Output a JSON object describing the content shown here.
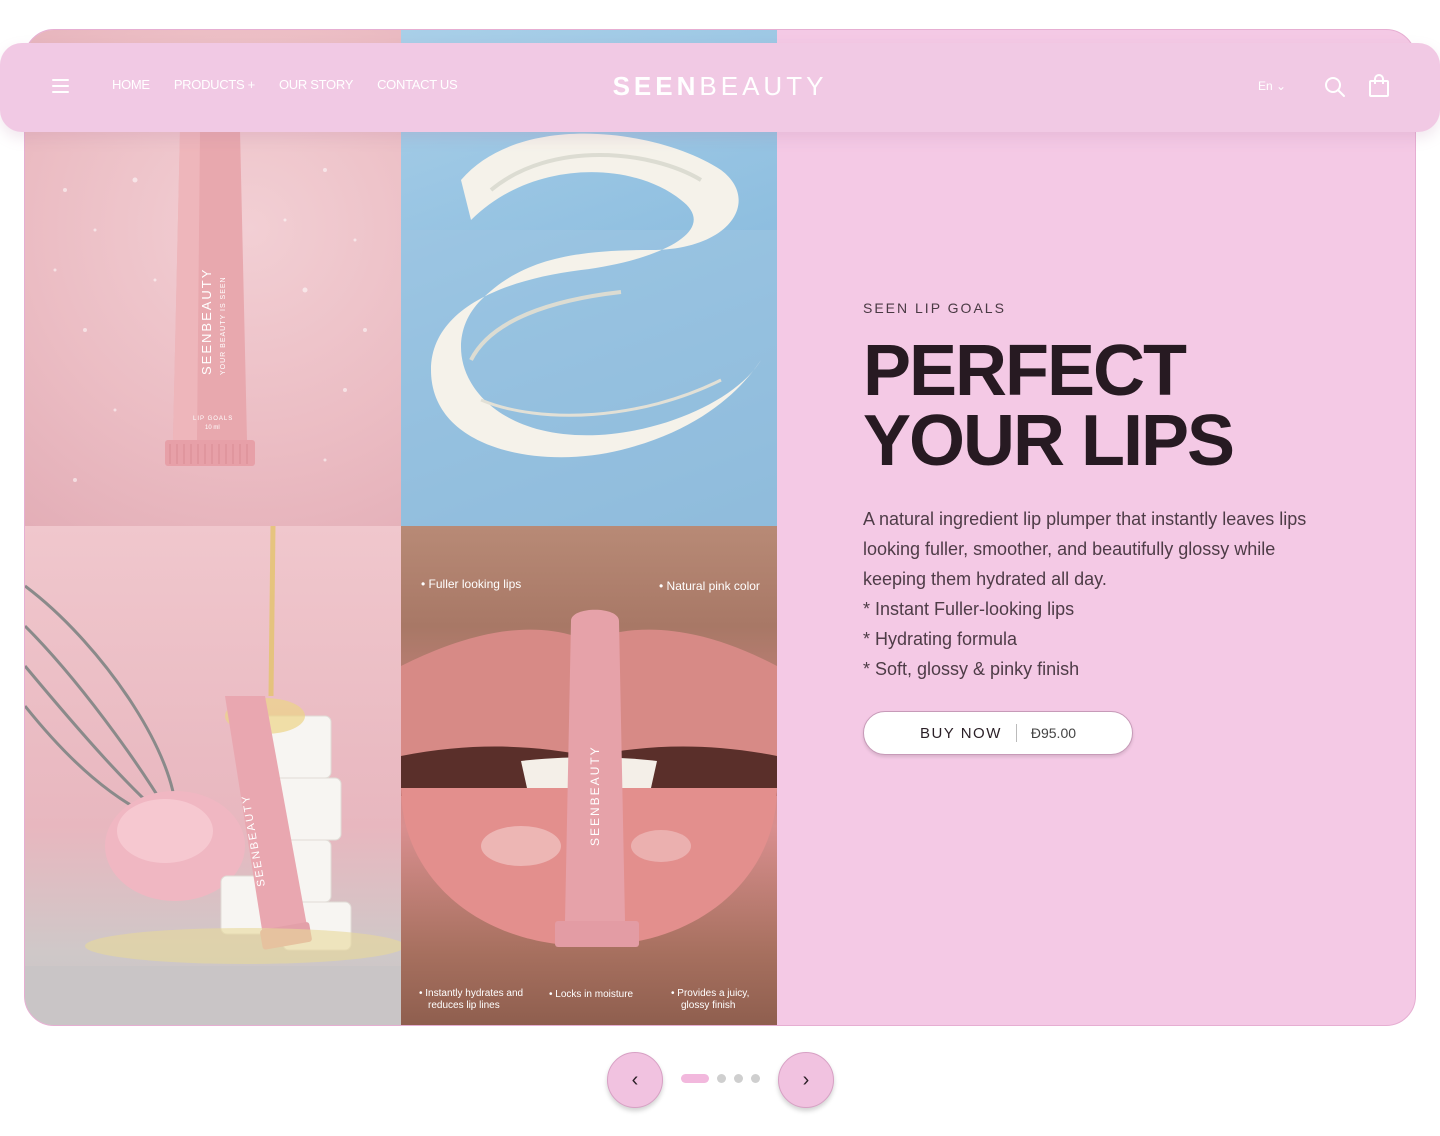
{
  "header": {
    "nav": [
      {
        "label": "HOME"
      },
      {
        "label": "PRODUCTS +"
      },
      {
        "label": "OUR STORY"
      },
      {
        "label": "CONTACT US"
      }
    ],
    "logo_bold": "SEEN",
    "logo_light": "BEAUTY",
    "lang_label": "En ⌄"
  },
  "tiles": {
    "tube_brand": "SEENBEAUTY",
    "tube_tagline": "YOUR BEAUTY IS SEEN",
    "tube_product": "LIP GOALS",
    "tube_size": "10 ml",
    "lips_callouts": {
      "top_left": "Fuller looking lips",
      "top_right": "Natural pink color",
      "bottom_1_line1": "Instantly hydrates and",
      "bottom_1_line2": "reduces lip lines",
      "bottom_2": "Locks in moisture",
      "bottom_3_line1": "Provides a juicy,",
      "bottom_3_line2": "glossy finish"
    }
  },
  "hero": {
    "eyebrow": "SEEN LIP GOALS",
    "headline_line1": "PERFECT",
    "headline_line2": "YOUR LIPS",
    "description": "A natural ingredient lip plumper that instantly leaves lips looking fuller, smoother, and beautifully glossy while keeping them hydrated all day.",
    "bullets": [
      "* Instant Fuller-looking lips",
      "* Hydrating formula",
      "* Soft, glossy & pinky finish"
    ],
    "buy_label": "BUY NOW",
    "price": "Ð95.00"
  },
  "slider": {
    "prev_icon": "‹",
    "next_icon": "›",
    "active_index": 0,
    "count": 4
  },
  "colors": {
    "hero_bg": "#f4c9e5",
    "header_bg": "#f1c9e4",
    "text_dark": "#271a22"
  }
}
